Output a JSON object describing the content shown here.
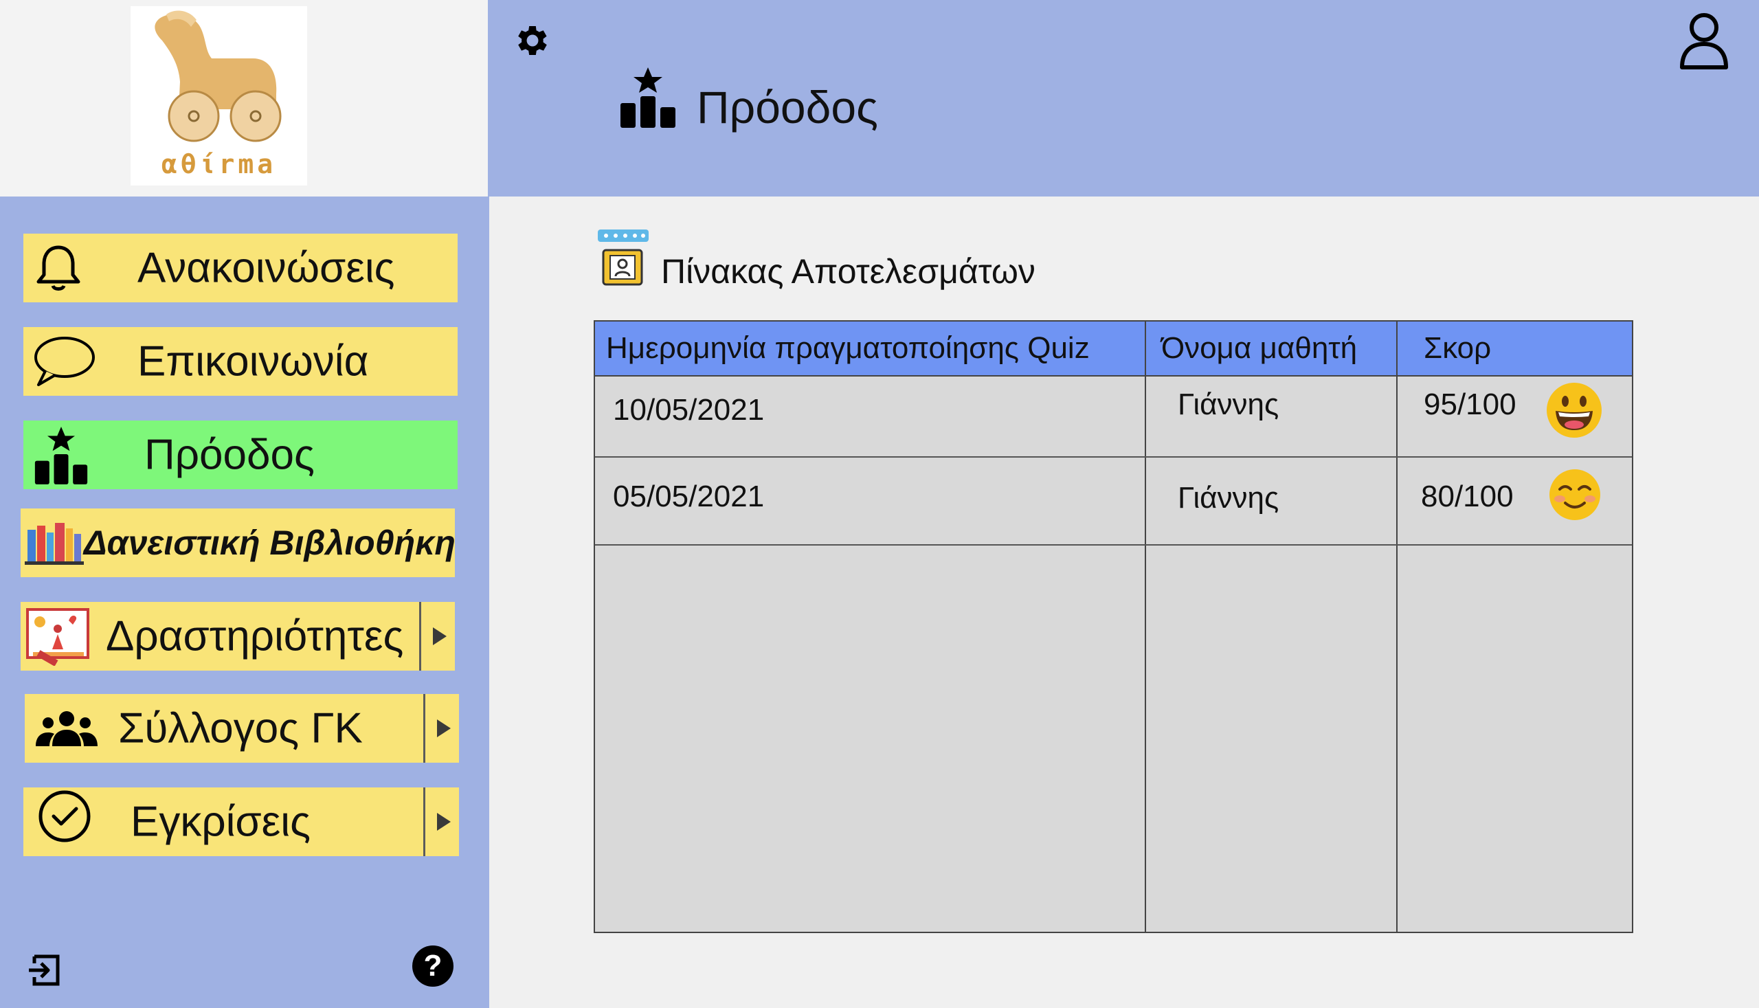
{
  "app": {
    "logo_text": "αθίrma"
  },
  "header": {
    "title": "Πρόοδος",
    "icons": [
      "gear-icon",
      "user-icon",
      "podium-icon"
    ]
  },
  "sidebar": {
    "items": [
      {
        "label": "Ανακοινώσεις",
        "icon": "bell-icon",
        "active": false,
        "has_submenu": false
      },
      {
        "label": "Επικοινωνία",
        "icon": "chat-bubble-icon",
        "active": false,
        "has_submenu": false
      },
      {
        "label": "Πρόοδος",
        "icon": "podium-icon",
        "active": true,
        "has_submenu": false
      },
      {
        "label": "Δανειστική Βιβλιοθήκη",
        "icon": "books-icon",
        "active": false,
        "has_submenu": false
      },
      {
        "label": "Δραστηριότητες",
        "icon": "drawing-icon",
        "active": false,
        "has_submenu": true
      },
      {
        "label": "Σύλλογος ΓΚ",
        "icon": "group-icon",
        "active": false,
        "has_submenu": true
      },
      {
        "label": "Εγκρίσεις",
        "icon": "check-circle-icon",
        "active": false,
        "has_submenu": true
      }
    ],
    "footer": {
      "logout_icon": "logout-icon",
      "help_label": "?"
    }
  },
  "main": {
    "section_title": "Πίνακας Αποτελεσμάτων",
    "table": {
      "headers": [
        "Ημερομηνία πραγματοποίησης Quiz",
        "Όνομα μαθητή",
        "Σκορ"
      ],
      "rows": [
        {
          "date": "10/05/2021",
          "student": "Γιάννης",
          "score": "95/100",
          "emoji": "grinning-face-icon"
        },
        {
          "date": "05/05/2021",
          "student": "Γιάννης",
          "score": "80/100",
          "emoji": "smiling-face-icon"
        }
      ]
    }
  },
  "colors": {
    "header_bg": "#9fb1e3",
    "nav_item": "#f9e478",
    "nav_active": "#7ef77a",
    "table_header": "#6f94f3",
    "table_body": "#d9d9d9"
  }
}
